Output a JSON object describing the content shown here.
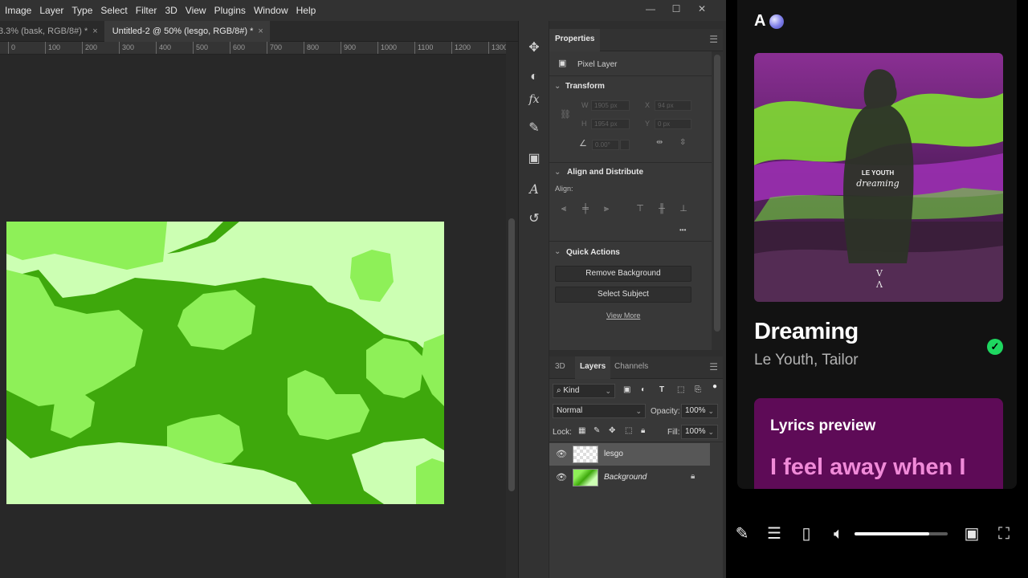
{
  "photoshop": {
    "menu": [
      "Image",
      "Layer",
      "Type",
      "Select",
      "Filter",
      "3D",
      "View",
      "Plugins",
      "Window",
      "Help"
    ],
    "window_controls": [
      "—",
      "☐",
      "✕"
    ],
    "tabs": [
      {
        "label": "3.3% (bask, RGB/8#) *",
        "close": "×"
      },
      {
        "label": "Untitled-2 @ 50% (lesgo, RGB/8#) *",
        "close": "×"
      }
    ],
    "ruler_ticks": [
      "0",
      "100",
      "200",
      "300",
      "400",
      "500",
      "600",
      "700",
      "800",
      "900",
      "1000",
      "1100",
      "1200",
      "1300"
    ],
    "canvas_colors": {
      "light": "#ccffb3",
      "mid": "#8ef058",
      "dark": "#3ea80c"
    },
    "properties": {
      "tab": "Properties",
      "layer_type": "Pixel Layer",
      "transform_heading": "Transform",
      "w_label": "W",
      "w_value": "1905 px",
      "x_label": "X",
      "x_value": "94 px",
      "h_label": "H",
      "h_value": "1954 px",
      "y_label": "Y",
      "y_value": "0 px",
      "angle_value": "0.00°",
      "align_heading": "Align and Distribute",
      "align_label": "Align:",
      "more": "•••",
      "quick_heading": "Quick Actions",
      "remove_bg": "Remove Background",
      "select_subject": "Select Subject",
      "view_more": "View More"
    },
    "layers": {
      "tabs": [
        "3D",
        "Layers",
        "Channels"
      ],
      "kind": "Kind",
      "blend": "Normal",
      "opacity_label": "Opacity:",
      "opacity_value": "100%",
      "lock_label": "Lock:",
      "fill_label": "Fill:",
      "fill_value": "100%",
      "rows": [
        {
          "name": "lesgo"
        },
        {
          "name": "Background"
        }
      ]
    }
  },
  "spotify": {
    "logo": "A",
    "cover_text_1": "LE YOUTH",
    "cover_text_2": "dreaming",
    "track_title": "Dreaming",
    "track_artist": "Le Youth, Tailor",
    "lyrics_heading": "Lyrics preview",
    "lyrics_line": "I feel away when I",
    "volume_fraction": 0.8,
    "accent": "#1ed760",
    "lyrics_bg": "#5e0b57"
  }
}
